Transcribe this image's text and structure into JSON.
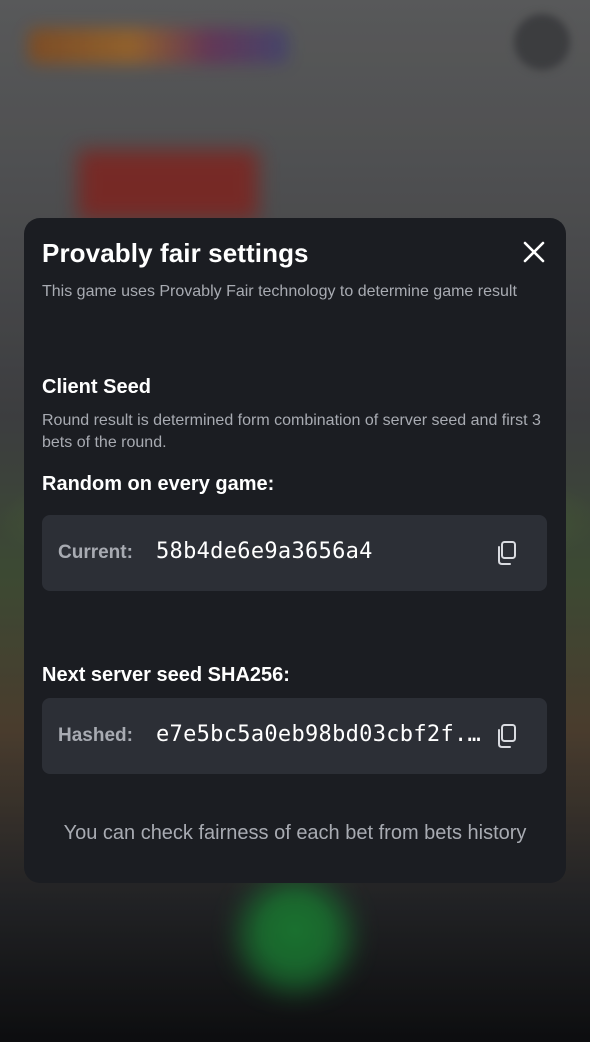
{
  "modal": {
    "title": "Provably fair settings",
    "subtitle": "This game uses Provably Fair technology to determine game result",
    "close_icon": "close-icon"
  },
  "client_seed": {
    "title": "Client Seed",
    "description": "Round result is determined form combination of server seed and first 3 bets of the round.",
    "random_label": "Random on every game:",
    "current_label": "Current:",
    "current_value": "58b4de6e9a3656a4",
    "copy_icon": "copy-icon"
  },
  "server_seed": {
    "title": "Next server seed SHA256:",
    "hashed_label": "Hashed:",
    "hashed_value": "e7e5bc5a0eb98bd03cbf2f...",
    "copy_icon": "copy-icon"
  },
  "footer": {
    "note": "You can check fairness of each bet from bets history"
  },
  "colors": {
    "modal_bg": "#1b1d22",
    "field_bg": "#2c2f36",
    "muted_text": "#a8abb2",
    "primary_text": "#ffffff"
  }
}
